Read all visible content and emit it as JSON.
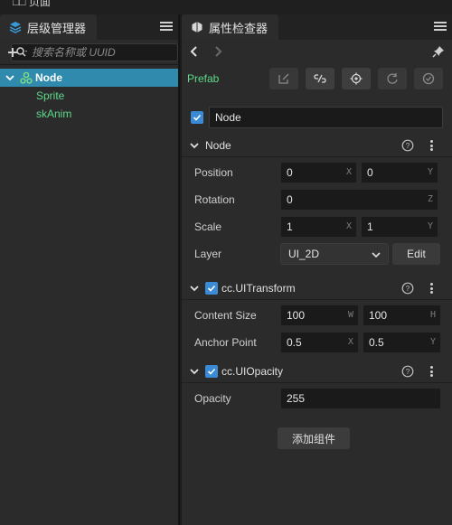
{
  "top_strip": {
    "cut_text": "□□ 页面"
  },
  "hierarchy": {
    "tab_label": "层级管理器",
    "search_placeholder": "搜索名称或 UUID",
    "tree": {
      "root": "Node",
      "children": [
        "Sprite",
        "skAnim"
      ]
    }
  },
  "inspector": {
    "tab_label": "属性检查器",
    "prefab_label": "Prefab",
    "node_name": "Node",
    "node_section": {
      "title": "Node",
      "position": {
        "label": "Position",
        "x": "0",
        "y": "0",
        "x_axis": "X",
        "y_axis": "Y"
      },
      "rotation": {
        "label": "Rotation",
        "z": "0",
        "z_axis": "Z"
      },
      "scale": {
        "label": "Scale",
        "x": "1",
        "y": "1",
        "x_axis": "X",
        "y_axis": "Y"
      },
      "layer": {
        "label": "Layer",
        "value": "UI_2D",
        "edit_label": "Edit"
      }
    },
    "ui_transform": {
      "title": "cc.UITransform",
      "content_size": {
        "label": "Content Size",
        "w": "100",
        "h": "100",
        "w_axis": "W",
        "h_axis": "H"
      },
      "anchor_point": {
        "label": "Anchor Point",
        "x": "0.5",
        "y": "0.5",
        "x_axis": "X",
        "y_axis": "Y"
      }
    },
    "ui_opacity": {
      "title": "cc.UIOpacity",
      "opacity": {
        "label": "Opacity",
        "value": "255"
      }
    },
    "add_component_label": "添加组件"
  },
  "colors": {
    "accent_blue": "#2f8aae",
    "checkbox_blue": "#3a8ad6",
    "green_text": "#5fd98a",
    "panel_bg": "#2b2b2b"
  },
  "icons": [
    "layers-icon",
    "menu-icon",
    "plus-icon",
    "search-icon",
    "list-icon",
    "chevron-down-icon",
    "node-icon",
    "inspector-icon",
    "back-arrow-icon",
    "forward-arrow-icon",
    "pin-icon",
    "edit-prefab-icon",
    "unlink-icon",
    "locate-icon",
    "revert-icon",
    "apply-icon",
    "check-icon",
    "help-icon",
    "more-icon"
  ]
}
